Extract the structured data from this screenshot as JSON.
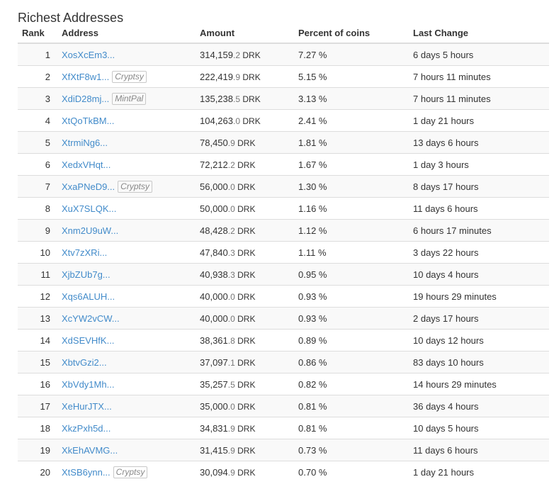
{
  "page": {
    "title": "Richest Addresses"
  },
  "table": {
    "headers": {
      "rank": "Rank",
      "address": "Address",
      "amount": "Amount",
      "percent": "Percent of coins",
      "last_change": "Last Change"
    },
    "unit": "DRK",
    "rows": [
      {
        "rank": "1",
        "address": "XosXcEm3...",
        "tag": "",
        "amount_int": "314,159",
        "amount_dec": ".2",
        "percent": "7.27 %",
        "last_change": "6 days 5 hours"
      },
      {
        "rank": "2",
        "address": "XfXtF8w1...",
        "tag": "Cryptsy",
        "amount_int": "222,419",
        "amount_dec": ".9",
        "percent": "5.15 %",
        "last_change": "7 hours 11 minutes"
      },
      {
        "rank": "3",
        "address": "XdiD28mj...",
        "tag": "MintPal",
        "amount_int": "135,238",
        "amount_dec": ".5",
        "percent": "3.13 %",
        "last_change": "7 hours 11 minutes"
      },
      {
        "rank": "4",
        "address": "XtQoTkBM...",
        "tag": "",
        "amount_int": "104,263",
        "amount_dec": ".0",
        "percent": "2.41 %",
        "last_change": "1 day 21 hours"
      },
      {
        "rank": "5",
        "address": "XtrmiNg6...",
        "tag": "",
        "amount_int": "78,450",
        "amount_dec": ".9",
        "percent": "1.81 %",
        "last_change": "13 days 6 hours"
      },
      {
        "rank": "6",
        "address": "XedxVHqt...",
        "tag": "",
        "amount_int": "72,212",
        "amount_dec": ".2",
        "percent": "1.67 %",
        "last_change": "1 day 3 hours"
      },
      {
        "rank": "7",
        "address": "XxaPNeD9...",
        "tag": "Cryptsy",
        "amount_int": "56,000",
        "amount_dec": ".0",
        "percent": "1.30 %",
        "last_change": "8 days 17 hours"
      },
      {
        "rank": "8",
        "address": "XuX7SLQK...",
        "tag": "",
        "amount_int": "50,000",
        "amount_dec": ".0",
        "percent": "1.16 %",
        "last_change": "11 days 6 hours"
      },
      {
        "rank": "9",
        "address": "Xnm2U9uW...",
        "tag": "",
        "amount_int": "48,428",
        "amount_dec": ".2",
        "percent": "1.12 %",
        "last_change": "6 hours 17 minutes"
      },
      {
        "rank": "10",
        "address": "Xtv7zXRi...",
        "tag": "",
        "amount_int": "47,840",
        "amount_dec": ".3",
        "percent": "1.11 %",
        "last_change": "3 days 22 hours"
      },
      {
        "rank": "11",
        "address": "XjbZUb7g...",
        "tag": "",
        "amount_int": "40,938",
        "amount_dec": ".3",
        "percent": "0.95 %",
        "last_change": "10 days 4 hours"
      },
      {
        "rank": "12",
        "address": "Xqs6ALUH...",
        "tag": "",
        "amount_int": "40,000",
        "amount_dec": ".0",
        "percent": "0.93 %",
        "last_change": "19 hours 29 minutes"
      },
      {
        "rank": "13",
        "address": "XcYW2vCW...",
        "tag": "",
        "amount_int": "40,000",
        "amount_dec": ".0",
        "percent": "0.93 %",
        "last_change": "2 days 17 hours"
      },
      {
        "rank": "14",
        "address": "XdSEVHfK...",
        "tag": "",
        "amount_int": "38,361",
        "amount_dec": ".8",
        "percent": "0.89 %",
        "last_change": "10 days 12 hours"
      },
      {
        "rank": "15",
        "address": "XbtvGzi2...",
        "tag": "",
        "amount_int": "37,097",
        "amount_dec": ".1",
        "percent": "0.86 %",
        "last_change": "83 days 10 hours"
      },
      {
        "rank": "16",
        "address": "XbVdy1Mh...",
        "tag": "",
        "amount_int": "35,257",
        "amount_dec": ".5",
        "percent": "0.82 %",
        "last_change": "14 hours 29 minutes"
      },
      {
        "rank": "17",
        "address": "XeHurJTX...",
        "tag": "",
        "amount_int": "35,000",
        "amount_dec": ".0",
        "percent": "0.81 %",
        "last_change": "36 days 4 hours"
      },
      {
        "rank": "18",
        "address": "XkzPxh5d...",
        "tag": "",
        "amount_int": "34,831",
        "amount_dec": ".9",
        "percent": "0.81 %",
        "last_change": "10 days 5 hours"
      },
      {
        "rank": "19",
        "address": "XkEhAVMG...",
        "tag": "",
        "amount_int": "31,415",
        "amount_dec": ".9",
        "percent": "0.73 %",
        "last_change": "11 days 6 hours"
      },
      {
        "rank": "20",
        "address": "XtSB6ynn...",
        "tag": "Cryptsy",
        "amount_int": "30,094",
        "amount_dec": ".9",
        "percent": "0.70 %",
        "last_change": "1 day 21 hours"
      }
    ]
  }
}
